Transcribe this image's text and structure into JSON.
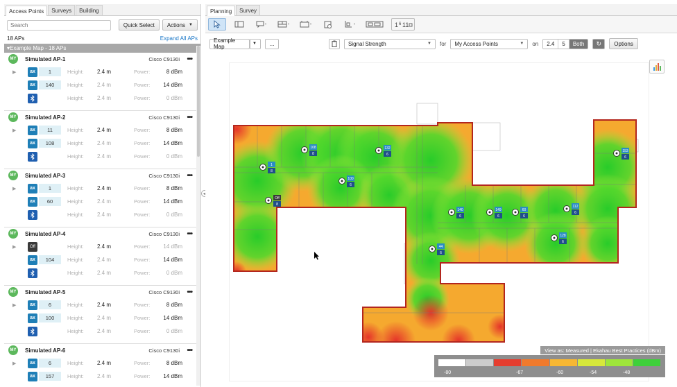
{
  "left_tabs": [
    "Access Points",
    "Surveys",
    "Building"
  ],
  "search": {
    "placeholder": "Search"
  },
  "buttons": {
    "quick_select": "Quick Select",
    "actions": "Actions"
  },
  "ap_count": "18 APs",
  "expand_all": "Expand All APs",
  "group_label": "Example Map - 18 APs",
  "labels": {
    "height": "Height:",
    "power": "Power:",
    "my": "MY"
  },
  "aps": [
    {
      "name": "Simulated AP-1",
      "model": "Cisco C9130i",
      "radios": [
        {
          "badge": "ax",
          "channel": "1",
          "height": "2.4  m",
          "power": "8  dBm"
        },
        {
          "badge": "ax",
          "channel": "140",
          "height": "2.4  m",
          "power": "14  dBm"
        },
        {
          "badge": "bt",
          "channel": "",
          "height": "2.4  m",
          "power": "0  dBm"
        }
      ]
    },
    {
      "name": "Simulated AP-2",
      "model": "Cisco C9130i",
      "radios": [
        {
          "badge": "ax",
          "channel": "11",
          "height": "2.4  m",
          "power": "8  dBm"
        },
        {
          "badge": "ax",
          "channel": "108",
          "height": "2.4  m",
          "power": "14  dBm"
        },
        {
          "badge": "bt",
          "channel": "",
          "height": "2.4  m",
          "power": "0  dBm"
        }
      ]
    },
    {
      "name": "Simulated AP-3",
      "model": "Cisco C9130i",
      "radios": [
        {
          "badge": "ax",
          "channel": "1",
          "height": "2.4  m",
          "power": "8  dBm"
        },
        {
          "badge": "ax",
          "channel": "60",
          "height": "2.4  m",
          "power": "14  dBm"
        },
        {
          "badge": "bt",
          "channel": "",
          "height": "2.4  m",
          "power": "0  dBm"
        }
      ]
    },
    {
      "name": "Simulated AP-4",
      "model": "Cisco C9130i",
      "radios": [
        {
          "badge": "Off",
          "channel": "",
          "height": "2.4  m",
          "power": "14  dBm"
        },
        {
          "badge": "ax",
          "channel": "104",
          "height": "2.4  m",
          "power": "14  dBm"
        },
        {
          "badge": "bt",
          "channel": "",
          "height": "2.4  m",
          "power": "0  dBm"
        }
      ]
    },
    {
      "name": "Simulated AP-5",
      "model": "Cisco C9130i",
      "radios": [
        {
          "badge": "ax",
          "channel": "6",
          "height": "2.4  m",
          "power": "8  dBm"
        },
        {
          "badge": "ax",
          "channel": "100",
          "height": "2.4  m",
          "power": "14  dBm"
        },
        {
          "badge": "bt",
          "channel": "",
          "height": "2.4  m",
          "power": "0  dBm"
        }
      ]
    },
    {
      "name": "Simulated AP-6",
      "model": "Cisco C9130i",
      "radios": [
        {
          "badge": "ax",
          "channel": "6",
          "height": "2.4  m",
          "power": "8  dBm"
        },
        {
          "badge": "ax",
          "channel": "157",
          "height": "2.4  m",
          "power": "14  dBm"
        }
      ]
    }
  ],
  "right_tabs": [
    "Planning",
    "Survey"
  ],
  "tools": [
    "pointer-icon",
    "wall-icon",
    "comment-icon",
    "brick-wall-icon",
    "door-icon",
    "ap-placement-icon",
    "measure-icon",
    "floor-icon",
    "channel-numbers-icon"
  ],
  "options_row": {
    "map_select": "Example Map",
    "more": "…",
    "visualization": "Signal Strength",
    "for_label": "for",
    "ap_filter": "My Access Points",
    "on_label": "on",
    "bands": [
      "2.4",
      "5",
      "Both"
    ],
    "active_band": "Both",
    "options": "Options"
  },
  "legend": {
    "caption": "View as: Measured  |  Ekahau Best Practices (dBm)",
    "ticks": [
      "-80",
      "-67",
      "-60",
      "-54",
      "-48"
    ],
    "colors": [
      "#ffffff",
      "#cccccc",
      "#e53d2f",
      "#f07a2c",
      "#f7b733",
      "#d7e83a",
      "#9ee53a",
      "#3ed03a"
    ]
  },
  "map": {
    "access_points": [
      {
        "label": "1",
        "sub": "8"
      },
      {
        "label": "108",
        "sub": "8"
      },
      {
        "label": "Off",
        "sub": "8"
      },
      {
        "label": "132",
        "sub": "6"
      },
      {
        "label": "100",
        "sub": "6"
      },
      {
        "label": "140",
        "sub": "6"
      },
      {
        "label": "44",
        "sub": "6"
      },
      {
        "label": "149",
        "sub": "6"
      },
      {
        "label": "60",
        "sub": "6"
      },
      {
        "label": "153",
        "sub": "6"
      },
      {
        "label": "112",
        "sub": "6"
      },
      {
        "label": "128",
        "sub": "6"
      }
    ]
  }
}
